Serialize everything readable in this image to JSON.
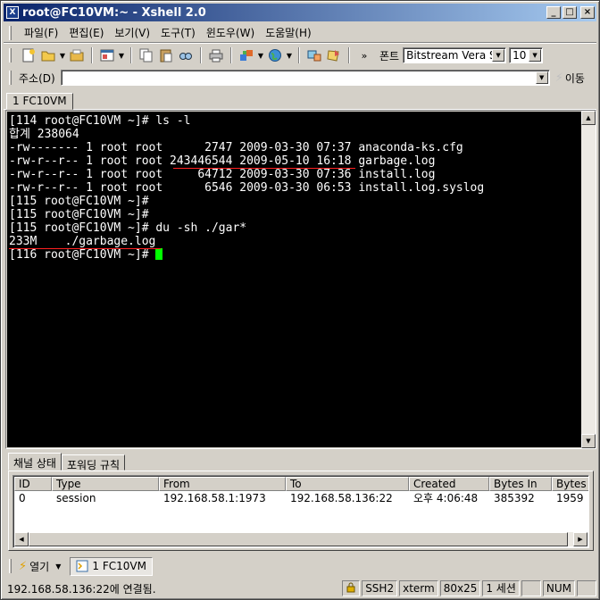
{
  "window": {
    "title": "root@FC10VM:~ - Xshell 2.0",
    "icon_label": "X",
    "minimize_icon": "_",
    "maximize_icon": "□",
    "close_icon": "×"
  },
  "menu": {
    "items": [
      "파일(F)",
      "편집(E)",
      "보기(V)",
      "도구(T)",
      "윈도우(W)",
      "도움말(H)"
    ]
  },
  "toolbar": {
    "icons": [
      "new-session-icon",
      "open-folder-icon",
      "folder-icon",
      "properties-icon",
      "copy-icon",
      "paste-icon",
      "find-icon",
      "print-icon",
      "transfer-icon",
      "globe-icon",
      "network-icon",
      "script-icon",
      "more-icon"
    ],
    "font_label": "폰트",
    "font_value": "Bitstream Vera S:",
    "size_value": "10"
  },
  "address": {
    "label": "주소(D)",
    "value": "",
    "go_label": "이동"
  },
  "session_tab": {
    "label": "1 FC10VM"
  },
  "terminal": {
    "lines": [
      "[114 root@FC10VM ~]# ls -l",
      "합계 238064",
      "-rw------- 1 root root      2747 2009-03-30 07:37 anaconda-ks.cfg",
      "-rw-r--r-- 1 root root 243446544 2009-05-10 16:18 garbage.log",
      "-rw-r--r-- 1 root root     64712 2009-03-30 07:36 install.log",
      "-rw-r--r-- 1 root root      6546 2009-03-30 06:53 install.log.syslog",
      "[115 root@FC10VM ~]#",
      "[115 root@FC10VM ~]#",
      "[115 root@FC10VM ~]# du -sh ./gar*",
      "233M    ./garbage.log",
      "[116 root@FC10VM ~]# "
    ],
    "cursor_color": "#00ff00",
    "underline_color": "#ff2020"
  },
  "panel": {
    "tabs": [
      "채널 상태",
      "포워딩 규칙"
    ],
    "columns": [
      "ID",
      "Type",
      "From",
      "To",
      "Created",
      "Bytes In",
      "Bytes C"
    ],
    "rows": [
      [
        "0",
        "session",
        "192.168.58.1:1973",
        "192.168.58.136:22",
        "오후 4:06:48",
        "385392",
        "1959"
      ]
    ]
  },
  "taskbar": {
    "open_label": "열기",
    "session_label": "1 FC10VM"
  },
  "status": {
    "message": "192.168.58.136:22에 연결됨.",
    "protocol": "SSH2",
    "term": "xterm",
    "size": "80x25",
    "sessions": "1 세션",
    "cell_empty": "",
    "num": "NUM"
  }
}
